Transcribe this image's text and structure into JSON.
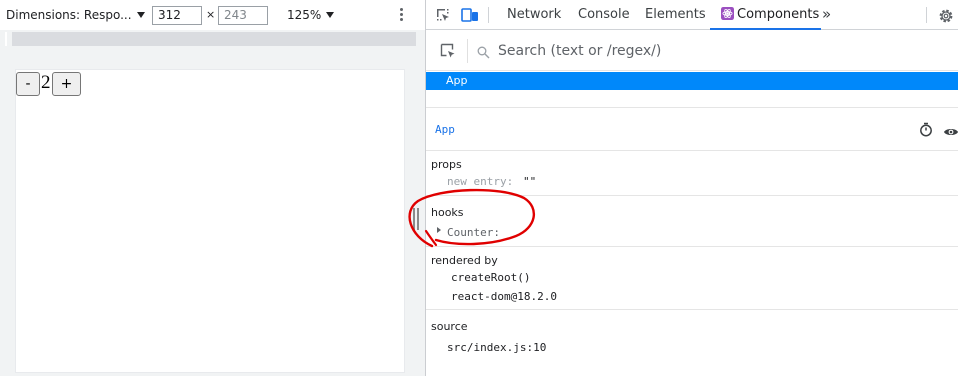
{
  "device_toolbar": {
    "dimensions_label": "Dimensions: Respo...",
    "width_value": "312",
    "times_symbol": "×",
    "height_value": "243",
    "zoom_label": "125%"
  },
  "viewport": {
    "decrement_label": "-",
    "count": "2",
    "increment_label": "+"
  },
  "devtools": {
    "tabs": [
      {
        "label": "Network"
      },
      {
        "label": "Console"
      },
      {
        "label": "Elements"
      },
      {
        "label": "Components"
      }
    ],
    "overflow_label": "»",
    "search_placeholder": "Search (text or /regex/)",
    "tree_selected": "App",
    "inspected_component": "App",
    "props": {
      "title": "props",
      "key": "new entry:",
      "value": "\"\""
    },
    "hooks": {
      "title": "hooks",
      "key": "Counter:"
    },
    "rendered_by": {
      "title": "rendered by",
      "items": [
        "createRoot()",
        "react-dom@18.2.0"
      ]
    },
    "source": {
      "title": "source",
      "value": "src/index.js:10"
    }
  },
  "colors": {
    "accent": "#1a73e8",
    "selection": "#0088fa",
    "annotation_red": "#e00000"
  },
  "icons": [
    "kebab-menu-icon",
    "inspect-element-icon",
    "device-toggle-icon",
    "react-components-icon",
    "settings-gear-icon",
    "select-element-icon",
    "search-icon",
    "stopwatch-icon",
    "eye-icon",
    "expand-triangle-icon"
  ]
}
